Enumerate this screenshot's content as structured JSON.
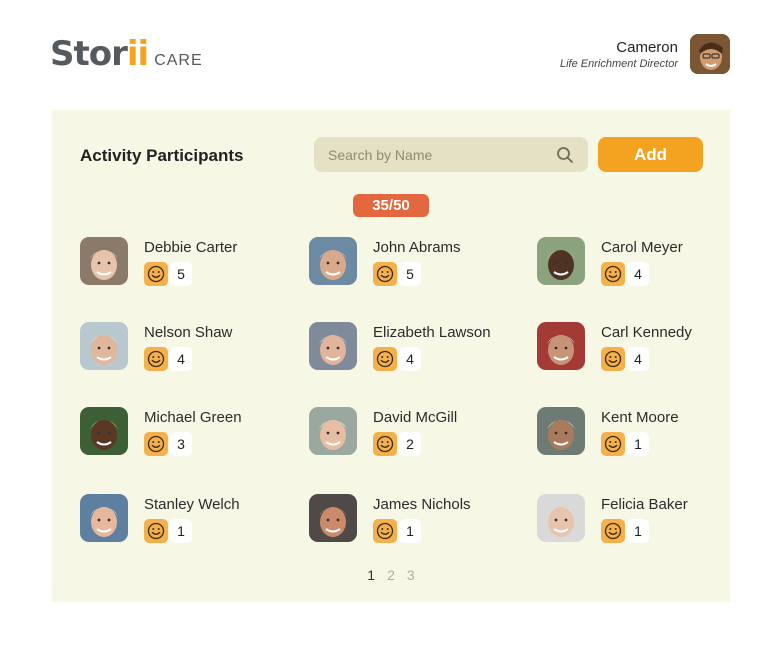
{
  "header": {
    "logo_main": "Stor",
    "logo_accent": "ii",
    "logo_sub": "CARE",
    "user_name": "Cameron",
    "user_role": "Life Enrichment Director"
  },
  "panel": {
    "title": "Activity Participants",
    "search_placeholder": "Search by Name",
    "add_label": "Add",
    "count": "35/50"
  },
  "participants": [
    {
      "name": "Debbie Carter",
      "score": "5",
      "skin": "#e7c3a9",
      "hair": "#d9d6d2",
      "bg": "#8b7a6a"
    },
    {
      "name": "John Abrams",
      "score": "5",
      "skin": "#d9a98c",
      "hair": "#cfcac6",
      "bg": "#6d8aa3"
    },
    {
      "name": "Carol Meyer",
      "score": "4",
      "skin": "#4f3424",
      "hair": "#c9b58f",
      "bg": "#8ba27f"
    },
    {
      "name": "Nelson Shaw",
      "score": "4",
      "skin": "#e0b79a",
      "hair": "#e8e0cf",
      "bg": "#b9c8cf"
    },
    {
      "name": "Elizabeth Lawson",
      "score": "4",
      "skin": "#e2b49b",
      "hair": "#dcdcdc",
      "bg": "#7f8a9a"
    },
    {
      "name": "Carl Kennedy",
      "score": "4",
      "skin": "#c89377",
      "hair": "#e6e3df",
      "bg": "#a33a36"
    },
    {
      "name": "Michael Green",
      "score": "3",
      "skin": "#5a3826",
      "hair": "#d7a640",
      "bg": "#3c5f35"
    },
    {
      "name": "David McGill",
      "score": "2",
      "skin": "#e9bda4",
      "hair": "#efefef",
      "bg": "#9aa8a0"
    },
    {
      "name": "Kent Moore",
      "score": "1",
      "skin": "#a97a5c",
      "hair": "#dcdcd8",
      "bg": "#6e7b74"
    },
    {
      "name": "Stanley Welch",
      "score": "1",
      "skin": "#e6b79c",
      "hair": "#d6d6d6",
      "bg": "#5d7fa0"
    },
    {
      "name": "James Nichols",
      "score": "1",
      "skin": "#c98b6b",
      "hair": "#9a7e6a",
      "bg": "#4f4a48"
    },
    {
      "name": "Felicia Baker",
      "score": "1",
      "skin": "#e9c4ad",
      "hair": "#e9e6e2",
      "bg": "#d9d9d9"
    }
  ],
  "pagination": [
    "1",
    "2",
    "3"
  ],
  "colors": {
    "accent": "#f4a321",
    "badge": "#e3683f",
    "panel_bg": "#f7f7e6",
    "mood_icon_bg": "#f4b04a"
  },
  "icons": {
    "search": "search-icon",
    "mood": "smiley-face-icon"
  }
}
